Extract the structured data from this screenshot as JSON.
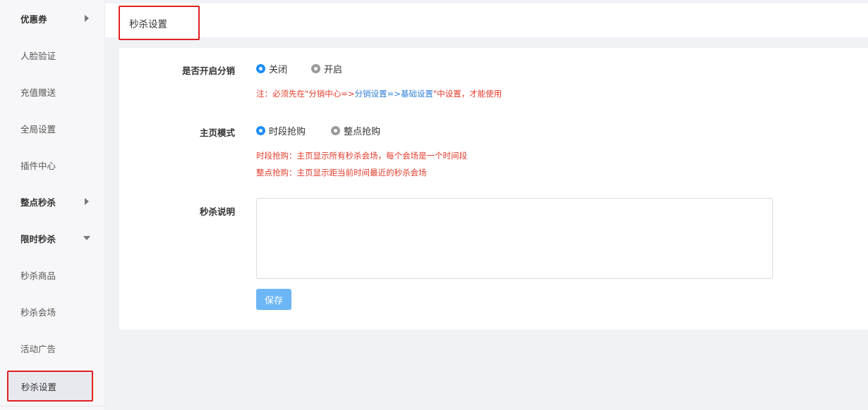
{
  "sidebar": {
    "items": [
      {
        "label": "优惠券"
      },
      {
        "label": "人脸验证"
      },
      {
        "label": "充值赠送"
      },
      {
        "label": "全局设置"
      },
      {
        "label": "插件中心"
      },
      {
        "label": "整点秒杀"
      },
      {
        "label": "限时秒杀"
      },
      {
        "label": "秒杀商品"
      },
      {
        "label": "秒杀会场"
      },
      {
        "label": "活动广告"
      },
      {
        "label": "秒杀设置"
      }
    ]
  },
  "header": {
    "title": "秒杀设置"
  },
  "form": {
    "distribution": {
      "label": "是否开启分销",
      "options": [
        {
          "label": "关闭",
          "selected": true
        },
        {
          "label": "开启",
          "selected": false
        }
      ],
      "note_prefix": "注：必须先在\"分销中心=>",
      "note_path": "分销设置=>基础设置",
      "note_suffix": "\"中设置，才能使用"
    },
    "home_mode": {
      "label": "主页模式",
      "options": [
        {
          "label": "时段抢购",
          "selected": true
        },
        {
          "label": "整点抢购",
          "selected": false
        }
      ],
      "hint1": "时段抢购：主页显示所有秒杀会场，每个会场是一个时间段",
      "hint2": "整点抢购：主页显示距当前时间最近的秒杀会场"
    },
    "description": {
      "label": "秒杀说明",
      "value": ""
    },
    "save_label": "保存"
  },
  "colors": {
    "accent": "#1e8ef7",
    "save_button": "#6cb6f5",
    "hint_text": "#e33a2a",
    "highlight_border": "#e02020"
  }
}
